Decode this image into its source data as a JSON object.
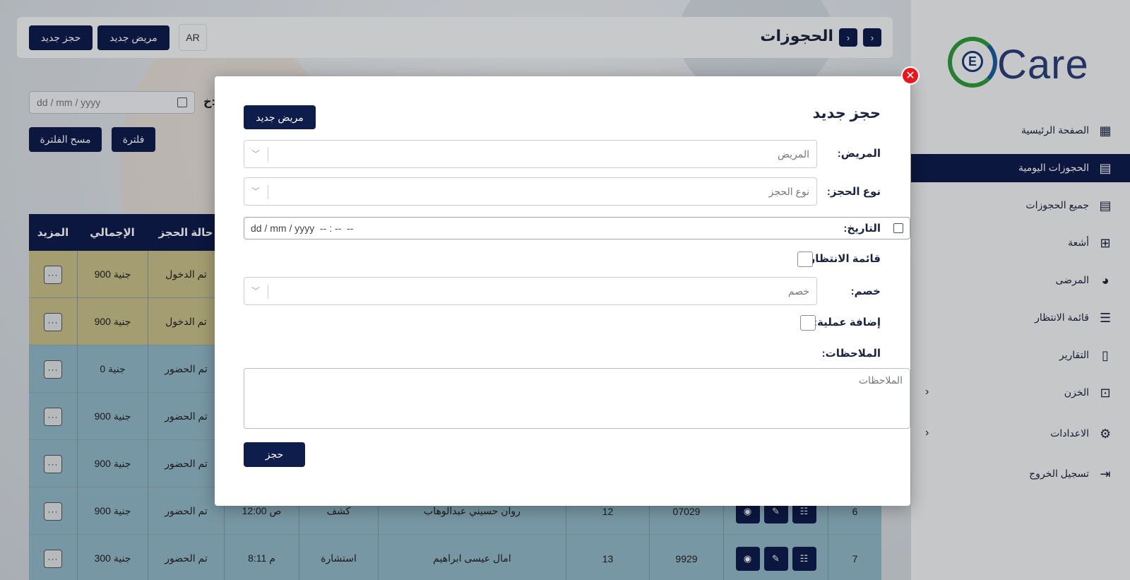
{
  "topbar": {
    "title": "الحجوزات",
    "new_booking_btn": "حجز جديد",
    "new_patient_btn": "مريض جديد",
    "lang": "AR"
  },
  "filters": {
    "date_placeholder": "dd / mm / yyyy",
    "date_label": "خ:",
    "filter_btn": "فلترة",
    "clear_btn": "مسح الفلترة"
  },
  "table": {
    "headers": {
      "more": "المزيد",
      "total": "الإجمالي",
      "status": "حالة الحجز"
    },
    "rows": [
      {
        "num": "",
        "total": "900 جنية",
        "status": "تم الدخول",
        "color": "tan",
        "time": "",
        "type": "",
        "name": "",
        "queue": "",
        "code": ""
      },
      {
        "num": "",
        "total": "900 جنية",
        "status": "تم الدخول",
        "color": "tan",
        "time": "",
        "type": "",
        "name": "",
        "queue": "",
        "code": ""
      },
      {
        "num": "",
        "total": "0 جنية",
        "status": "تم الحضور",
        "color": "blue",
        "time": "",
        "type": "",
        "name": "",
        "queue": "",
        "code": ""
      },
      {
        "num": "",
        "total": "900 جنية",
        "status": "تم الحضور",
        "color": "blue",
        "time": "",
        "type": "",
        "name": "",
        "queue": "",
        "code": ""
      },
      {
        "num": "",
        "total": "900 جنية",
        "status": "تم الحضور",
        "color": "blue",
        "time": "",
        "type": "",
        "name": "",
        "queue": "",
        "code": ""
      },
      {
        "num": "6",
        "total": "900 جنية",
        "status": "تم الحضور",
        "color": "blue",
        "time": "12:00 ص",
        "type": "كشف",
        "name": "روان حسيني عبدالوهاب",
        "queue": "12",
        "code": "07029"
      },
      {
        "num": "7",
        "total": "300 جنية",
        "status": "تم الحضور",
        "color": "blue",
        "time": "8:11 م",
        "type": "استشارة",
        "name": "امال عيسى ابراهيم",
        "queue": "13",
        "code": "9929"
      }
    ],
    "more_glyph": "···"
  },
  "sidebar": {
    "brand": "Care",
    "brand_letter": "E",
    "items": [
      {
        "label": "الصفحة الرئيسية",
        "icon": "dashboard-icon",
        "glyph": "▦",
        "active": false,
        "chev": false
      },
      {
        "label": "الحجوزات اليومية",
        "icon": "calendar-icon",
        "glyph": "▤",
        "active": true,
        "chev": false
      },
      {
        "label": "جميع الحجوزات",
        "icon": "calendar-icon",
        "glyph": "▤",
        "active": false,
        "chev": false
      },
      {
        "label": "أشعة",
        "icon": "xray-icon",
        "glyph": "⊞",
        "active": false,
        "chev": false
      },
      {
        "label": "المرضى",
        "icon": "patients-icon",
        "glyph": "◕",
        "active": false,
        "chev": false
      },
      {
        "label": "قائمة الانتظار",
        "icon": "queue-icon",
        "glyph": "☰",
        "active": false,
        "chev": false
      },
      {
        "label": "التقارير",
        "icon": "clipboard-icon",
        "glyph": "▯",
        "active": false,
        "chev": false
      },
      {
        "label": "الخزن",
        "icon": "cash-icon",
        "glyph": "⊡",
        "active": false,
        "chev": true
      },
      {
        "label": "الاعدادات",
        "icon": "gear-icon",
        "glyph": "⚙",
        "active": false,
        "chev": true
      },
      {
        "label": "تسجيل الخروج",
        "icon": "logout-icon",
        "glyph": "⇥",
        "active": false,
        "chev": false
      }
    ]
  },
  "modal": {
    "title": "حجز جديد",
    "new_patient_btn": "مريض جديد",
    "patient_label": "المريض:",
    "patient_placeholder": "المريض",
    "booking_type_label": "نوع الحجز:",
    "booking_type_placeholder": "نوع الحجز",
    "date_label": "التاريخ:",
    "date_placeholder": "dd / mm / yyyy  -- : --  --",
    "waitlist_label": "قائمة الانتظار:",
    "discount_label": "خصم:",
    "discount_placeholder": "خصم",
    "add_procedure_label": "إضافة عملية:",
    "notes_label": "الملاحظات:",
    "notes_placeholder": "الملاحظات",
    "submit_btn": "حجز",
    "close_glyph": "✕"
  }
}
